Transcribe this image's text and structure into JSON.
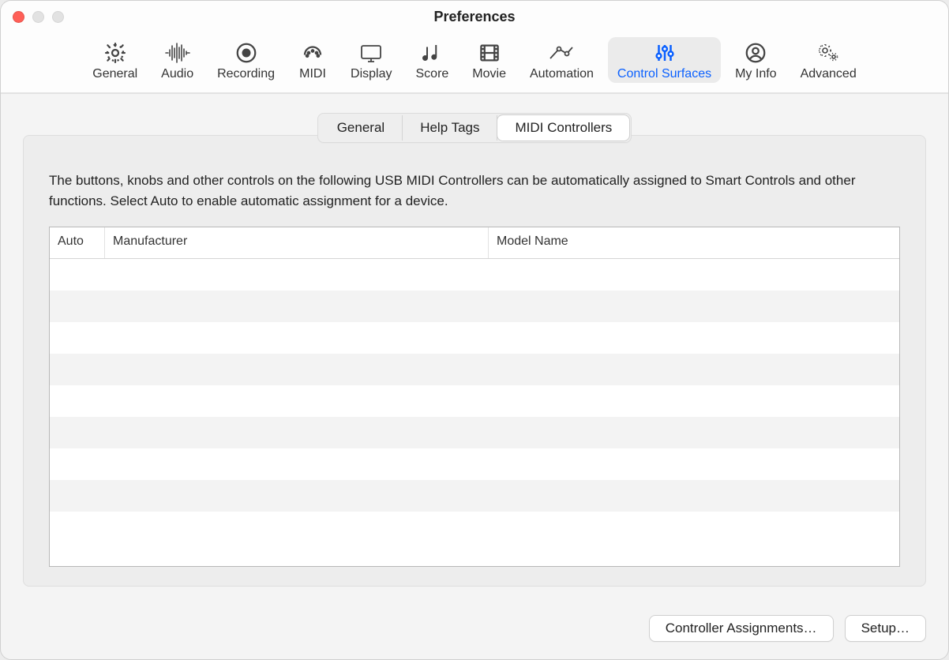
{
  "window": {
    "title": "Preferences"
  },
  "toolbar": {
    "items": [
      {
        "label": "General"
      },
      {
        "label": "Audio"
      },
      {
        "label": "Recording"
      },
      {
        "label": "MIDI"
      },
      {
        "label": "Display"
      },
      {
        "label": "Score"
      },
      {
        "label": "Movie"
      },
      {
        "label": "Automation"
      },
      {
        "label": "Control Surfaces"
      },
      {
        "label": "My Info"
      },
      {
        "label": "Advanced"
      }
    ],
    "active_index": 8
  },
  "segmented": {
    "tabs": [
      {
        "label": "General"
      },
      {
        "label": "Help Tags"
      },
      {
        "label": "MIDI Controllers"
      }
    ],
    "active_index": 2
  },
  "content": {
    "description": "The buttons, knobs and other controls on the following USB MIDI Controllers can be automatically assigned to Smart Controls and other functions. Select Auto to enable automatic assignment for a device.",
    "columns": {
      "auto": "Auto",
      "manufacturer": "Manufacturer",
      "model_name": "Model Name"
    },
    "rows": []
  },
  "footer": {
    "controller_assignments": "Controller Assignments…",
    "setup": "Setup…"
  }
}
